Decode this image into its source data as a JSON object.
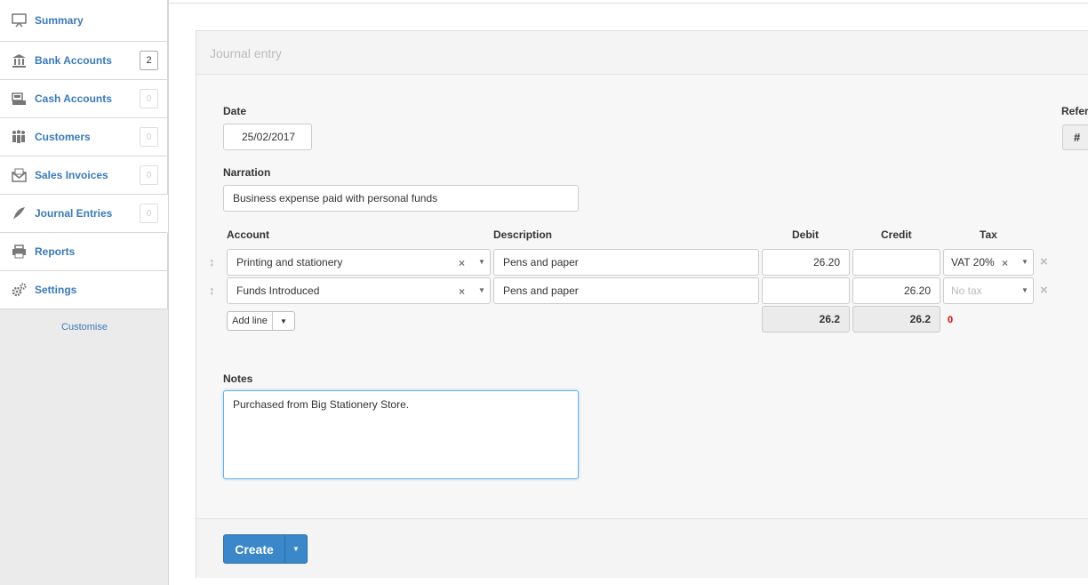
{
  "sidebar": {
    "items": [
      {
        "label": "Summary",
        "icon": "monitor-icon",
        "badge": ""
      },
      {
        "label": "Bank Accounts",
        "icon": "bank-icon",
        "badge": "2"
      },
      {
        "label": "Cash Accounts",
        "icon": "cash-register-icon",
        "badge": "0"
      },
      {
        "label": "Customers",
        "icon": "people-icon",
        "badge": "0"
      },
      {
        "label": "Sales Invoices",
        "icon": "envelope-icon",
        "badge": "0"
      },
      {
        "label": "Journal Entries",
        "icon": "quill-icon",
        "badge": "0"
      },
      {
        "label": "Reports",
        "icon": "printer-icon",
        "badge": ""
      },
      {
        "label": "Settings",
        "icon": "gears-icon",
        "badge": ""
      }
    ],
    "customise": "Customise"
  },
  "form": {
    "title": "Journal entry",
    "date_label": "Date",
    "date_value": "25/02/2017",
    "reference_label": "Refer",
    "reference_button": "#",
    "narration_label": "Narration",
    "narration_value": "Business expense paid with personal funds",
    "columns": {
      "account": "Account",
      "description": "Description",
      "debit": "Debit",
      "credit": "Credit",
      "tax": "Tax"
    },
    "lines": [
      {
        "account": "Printing and stationery",
        "description": "Pens and paper",
        "debit": "26.20",
        "credit": "",
        "tax": "VAT 20%"
      },
      {
        "account": "Funds Introduced",
        "description": "Pens and paper",
        "debit": "",
        "credit": "26.20",
        "tax": "No tax"
      }
    ],
    "add_line_label": "Add line",
    "total_debit": "26.2",
    "total_credit": "26.2",
    "balance": "0",
    "notes_label": "Notes",
    "notes_value": "Purchased from Big Stationery Store.",
    "create_label": "Create"
  },
  "colors": {
    "accent": "#3a87c9",
    "link": "#3a7ab8",
    "error": "#dd0000"
  }
}
